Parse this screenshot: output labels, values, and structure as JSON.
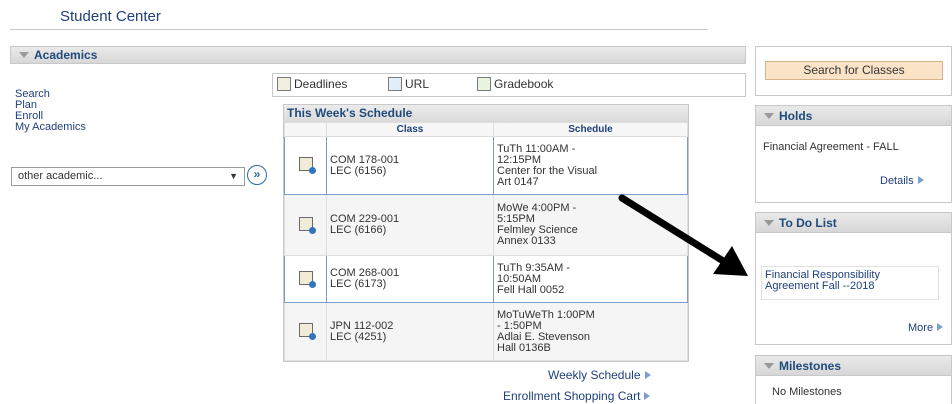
{
  "header": {
    "title": "Student Center"
  },
  "academics": {
    "heading": "Academics",
    "links": [
      "Search",
      "Plan",
      "Enroll",
      "My Academics"
    ],
    "dropdown": {
      "value": "other academic...",
      "caret": "▼"
    },
    "go_icon": "double-chevron-right-icon",
    "go_label": "»"
  },
  "toolbar": {
    "deadlines": "Deadlines",
    "url": "URL",
    "gradebook": "Gradebook"
  },
  "schedule": {
    "title": "This Week's Schedule",
    "columns": [
      "Class",
      "Schedule"
    ],
    "rows": [
      {
        "class_line1": "COM 178-001",
        "class_line2": "LEC (6156)",
        "schedule": [
          "TuTh 11:00AM -",
          "12:15PM",
          "Center for the Visual",
          "Art 0147"
        ]
      },
      {
        "class_line1": "COM 229-001",
        "class_line2": "LEC (6166)",
        "schedule": [
          "MoWe 4:00PM -",
          "5:15PM",
          "Felmley Science",
          "Annex 0133"
        ]
      },
      {
        "class_line1": "COM 268-001",
        "class_line2": "LEC (6173)",
        "schedule": [
          "TuTh 9:35AM -",
          "10:50AM",
          "Fell Hall 0052"
        ]
      },
      {
        "class_line1": "JPN 112-002",
        "class_line2": "LEC (4251)",
        "schedule": [
          "MoTuWeTh 1:00PM",
          "- 1:50PM",
          "Adlai E. Stevenson",
          "Hall 0136B"
        ]
      }
    ],
    "weekly_link": "Weekly Schedule",
    "cart_link": "Enrollment Shopping Cart"
  },
  "right": {
    "search_button": "Search for Classes",
    "holds": {
      "heading": "Holds",
      "item": "Financial Agreement - FALL",
      "details": "Details"
    },
    "todo": {
      "heading": "To Do List",
      "item": "Financial Responsibility Agreement Fall --2018",
      "more": "More"
    },
    "milestones": {
      "heading": "Milestones",
      "item": "No Milestones"
    }
  },
  "colors": {
    "link": "#1f3f7a",
    "accent_button": "#fbe3c8",
    "section_bar": "#dcdcdc"
  }
}
